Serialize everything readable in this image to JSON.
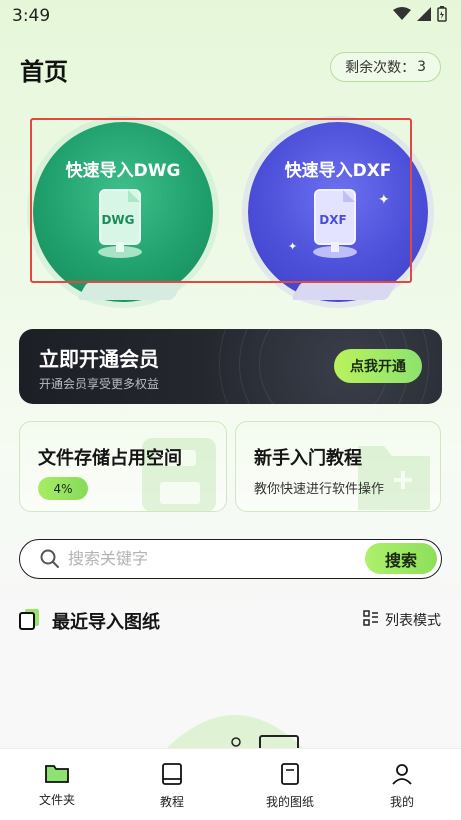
{
  "status_bar": {
    "time": "3:49"
  },
  "header": {
    "title": "首页",
    "remaining_label": "剩余次数：",
    "remaining_count": "3"
  },
  "import": {
    "dwg": {
      "label": "快速导入DWG",
      "file_text": "DWG"
    },
    "dxf": {
      "label": "快速导入DXF",
      "file_text": "DXF"
    }
  },
  "vip": {
    "title": "立即开通会员",
    "subtitle": "开通会员享受更多权益",
    "button": "点我开通"
  },
  "storage": {
    "title": "文件存储占用空间",
    "percent": "4%"
  },
  "tutorial": {
    "title": "新手入门教程",
    "subtitle": "教你快速进行软件操作"
  },
  "search": {
    "placeholder": "搜索关键字",
    "button": "搜索"
  },
  "recent": {
    "title": "最近导入图纸",
    "list_mode": "列表模式"
  },
  "nav": {
    "items": [
      {
        "label": "文件夹",
        "icon": "folder-icon"
      },
      {
        "label": "教程",
        "icon": "book-icon"
      },
      {
        "label": "我的图纸",
        "icon": "drawing-icon"
      },
      {
        "label": "我的",
        "icon": "user-icon"
      }
    ]
  },
  "colors": {
    "accent": "#8de05a",
    "dwg": "#1fa06c",
    "dxf": "#4c4fd8",
    "vip_bg": "#1c1f25",
    "highlight": "#e2483f"
  }
}
